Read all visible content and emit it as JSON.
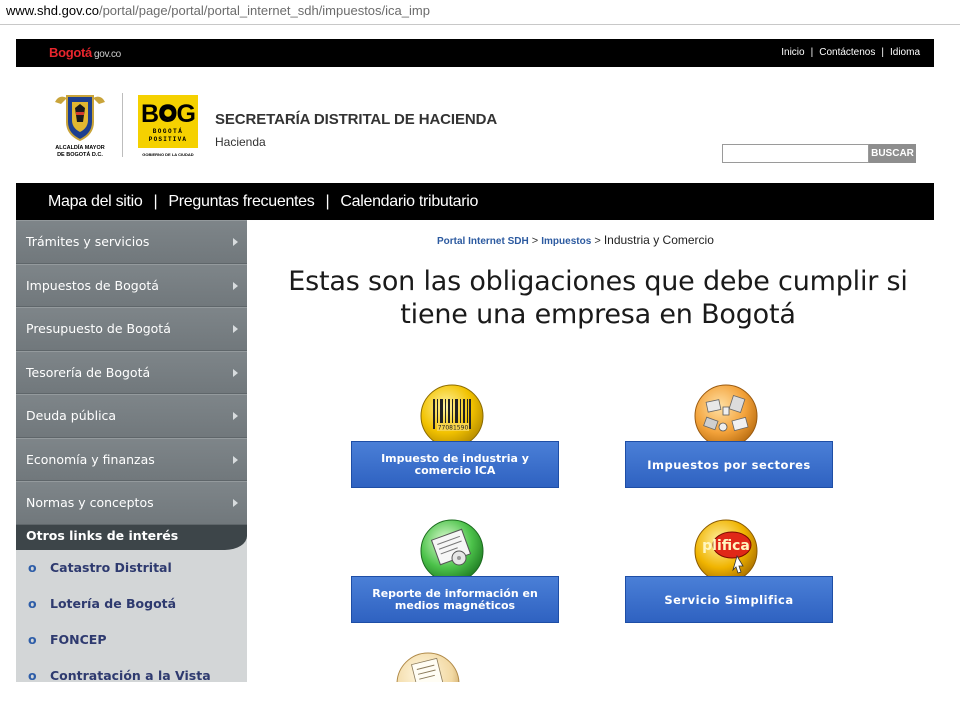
{
  "browser": {
    "url_host": "www.shd.gov.co",
    "url_path": "/portal/page/portal/portal_internet_sdh/impuestos/ica_imp"
  },
  "topbar": {
    "brand": "Bogotá",
    "brand_suffix": "gov.co",
    "links": [
      "Inicio",
      "Contáctenos",
      "Idioma"
    ],
    "separator": "|"
  },
  "header": {
    "logo_bog_caption": "ALCALDÍA MAYOR DE BOGOTÁ D.C.",
    "logo_pos_top": "BOG",
    "logo_pos_mid": "BOGOTÁ POSITIVA",
    "logo_pos_bottom": "GOBIERNO DE LA CIUDAD",
    "title": "SECRETARÍA DISTRITAL DE HACIENDA",
    "subtitle": "Hacienda",
    "search_placeholder": "",
    "search_button": "BUSCAR"
  },
  "mainnav": {
    "items": [
      "Mapa del sitio",
      "Preguntas frecuentes",
      "Calendario tributario"
    ],
    "separator": "|"
  },
  "sidebar": {
    "menu": [
      "Trámites y servicios",
      "Impuestos de Bogotá",
      "Presupuesto de Bogotá",
      "Tesorería de Bogotá",
      "Deuda pública",
      "Economía y finanzas",
      "Normas y conceptos"
    ],
    "other_links_title": "Otros links de interés",
    "bullet": "o",
    "other_links": [
      "Catastro Distrital",
      "Lotería de Bogotá",
      "FONCEP",
      "Contratación a la Vista"
    ]
  },
  "breadcrumb": {
    "items": [
      "Portal Internet SDH",
      "Impuestos"
    ],
    "sep": ">",
    "current": "Industria y Comercio"
  },
  "headline": "Estas son las obligaciones que debe cumplir si tiene una empresa en Bogotá",
  "tiles": [
    {
      "label": "Impuesto de industria y comercio ICA",
      "icon": "barcode-icon"
    },
    {
      "label": "Impuestos por sectores",
      "icon": "sectors-icon"
    },
    {
      "label": "Reporte de información en medios magnéticos",
      "icon": "document-icon"
    },
    {
      "label": "Servicio Simplifica",
      "icon": "simplifica-icon"
    }
  ],
  "simplifica_text": "plifica",
  "barcode_text": "77081590",
  "colors": {
    "tile_blue": "#3468c8",
    "sidebar_gray": "#777e82",
    "brand_red": "#e8262d",
    "link_blue": "#2c5aa0"
  }
}
